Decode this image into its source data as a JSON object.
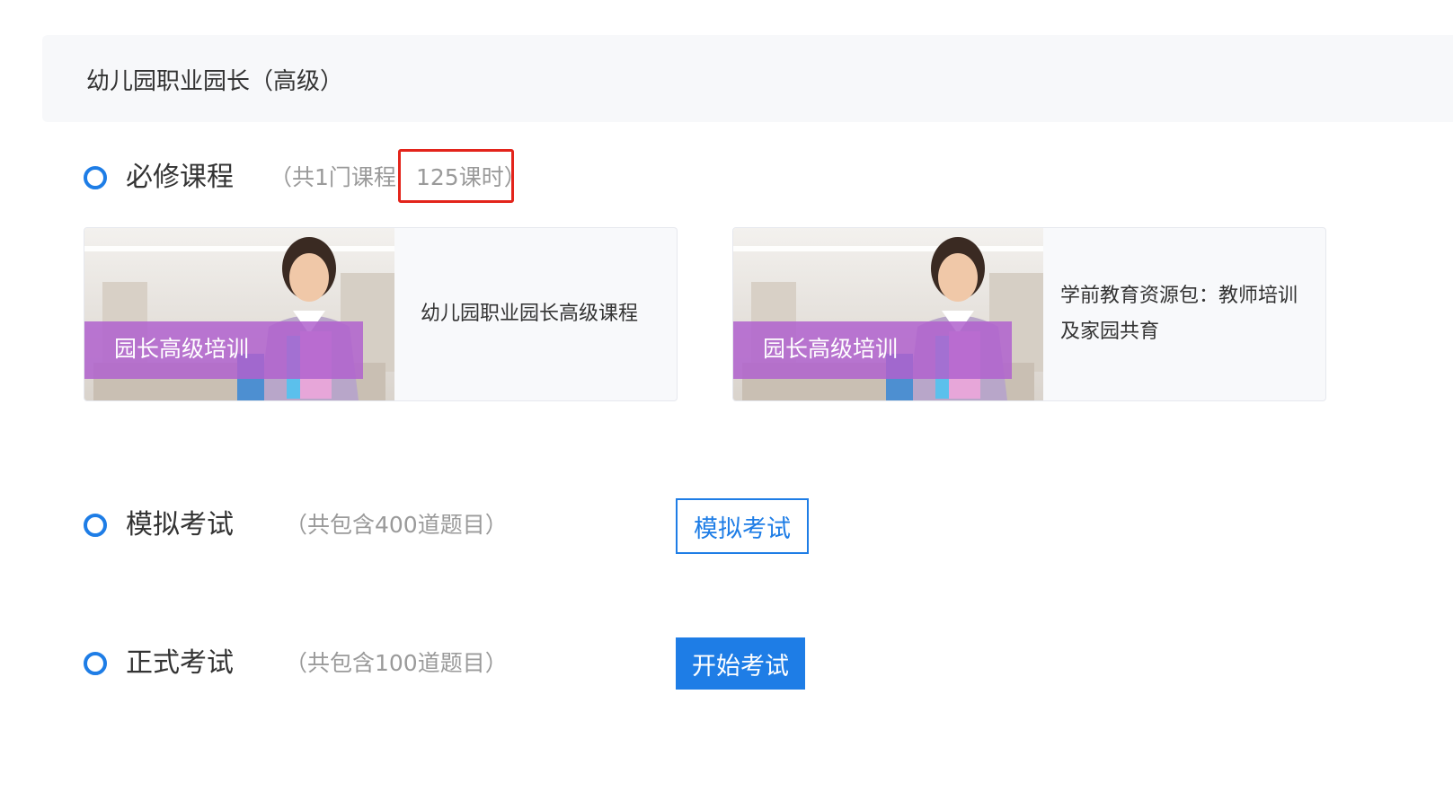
{
  "header": {
    "title": "幼儿园职业园长（高级）"
  },
  "required": {
    "title": "必修课程",
    "note_count": "（共1门课程",
    "note_hours": "125课时）",
    "courses": [
      {
        "badge": "园长高级培训",
        "title": "幼儿园职业园长高级课程"
      },
      {
        "badge": "园长高级培训",
        "title": "学前教育资源包：教师培训及家园共育"
      }
    ]
  },
  "mock_exam": {
    "title": "模拟考试",
    "note": "（共包含400道题目）",
    "button_label": "模拟考试"
  },
  "formal_exam": {
    "title": "正式考试",
    "note": "（共包含100道题目）",
    "button_label": "开始考试"
  },
  "colors": {
    "accent": "#1e7de6",
    "badge": "#b062ce",
    "highlight": "#e3241b"
  },
  "icons": {
    "section_marker": "circle-ring-icon",
    "course_thumb": "teacher-photo"
  }
}
